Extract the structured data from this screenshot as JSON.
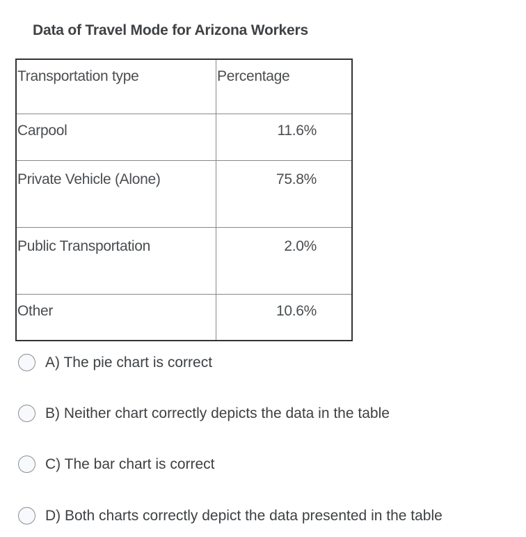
{
  "title": "Data of Travel Mode for Arizona Workers",
  "table": {
    "headers": [
      "Transportation type",
      "Percentage"
    ],
    "rows": [
      {
        "type": "Carpool",
        "percentage": "11.6%"
      },
      {
        "type": "Private Vehicle (Alone)",
        "percentage": "75.8%"
      },
      {
        "type": "Public Transportation",
        "percentage": "2.0%"
      },
      {
        "type": "Other",
        "percentage": "10.6%"
      }
    ]
  },
  "options": [
    {
      "label": "A) The pie chart is correct",
      "selected": false
    },
    {
      "label": "B) Neither chart correctly depicts the data in the table",
      "selected": false
    },
    {
      "label": "C) The bar chart is correct",
      "selected": false
    },
    {
      "label": "D) Both charts correctly depict the data presented in the table",
      "selected": false
    }
  ]
}
